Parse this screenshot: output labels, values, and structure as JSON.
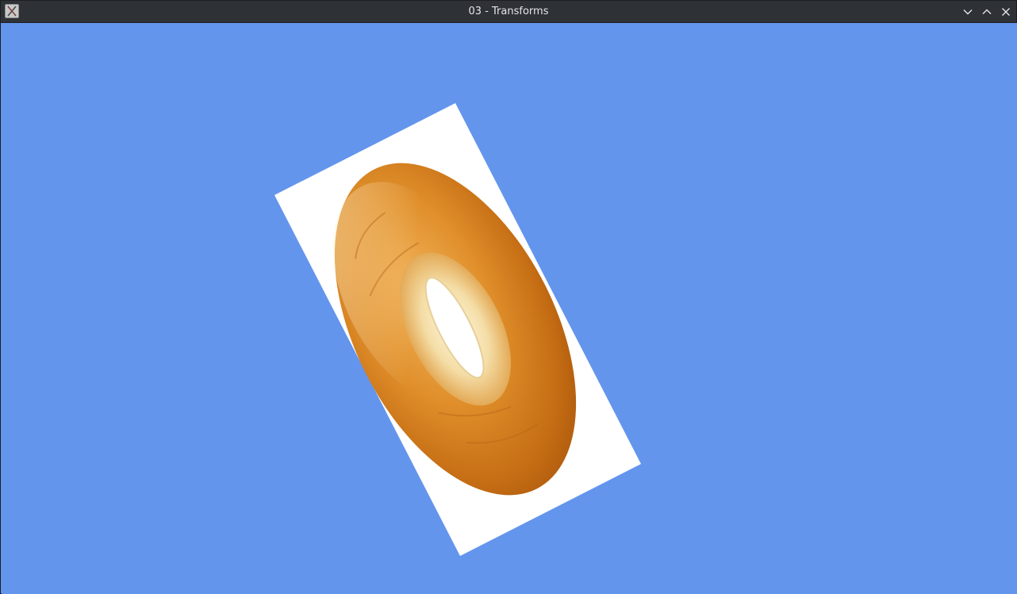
{
  "window": {
    "title": "03 - Transforms",
    "clear_color": "#6495ed",
    "app_icon": "x11-app-icon",
    "buttons": [
      {
        "name": "minimize-button",
        "icon": "chevron-down-icon"
      },
      {
        "name": "maximize-button",
        "icon": "chevron-up-icon"
      },
      {
        "name": "close-button",
        "icon": "close-icon"
      }
    ]
  },
  "scene": {
    "quad_color": "#ffffff",
    "texture_subject": "bagel"
  }
}
